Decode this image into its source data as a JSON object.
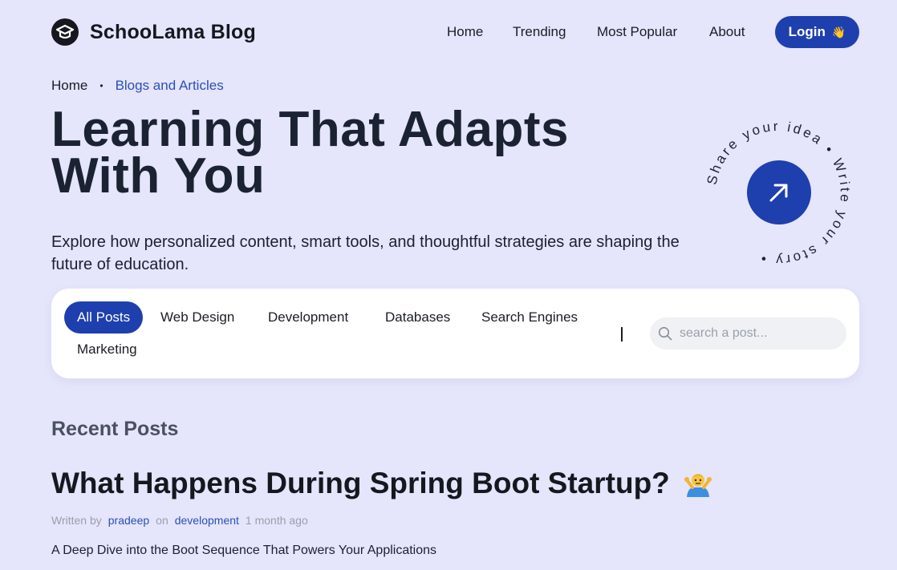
{
  "header": {
    "brand": "SchooLama Blog",
    "nav": [
      "Home",
      "Trending",
      "Most Popular",
      "About"
    ],
    "login_label": "Login",
    "login_emoji": "👋"
  },
  "breadcrumb": {
    "home": "Home",
    "separator": "•",
    "current": "Blogs and Articles"
  },
  "hero": {
    "title_line1": "Learning That Adapts",
    "title_line2": "With You",
    "description": "Explore how personalized content, smart tools, and thoughtful strategies are shaping the future of education.",
    "circle_text": "Share your idea • Write your story •"
  },
  "filters": {
    "categories": [
      "All Posts",
      "Web Design",
      "Development",
      "Databases",
      "Search Engines",
      "Marketing"
    ],
    "active": "All Posts",
    "search_placeholder": "search a post..."
  },
  "posts": {
    "section_title": "Recent Posts",
    "items": [
      {
        "title": "What Happens During Spring Boot Startup?",
        "written_by_label": "Written by",
        "author": "pradeep",
        "on_label": "on",
        "category": "development",
        "time": "1 month ago",
        "excerpt": "A Deep Dive into the Boot Sequence That Powers Your Applications"
      }
    ]
  },
  "colors": {
    "background": "#e5e5fb",
    "accent": "#1e3fae",
    "link": "#2b4fb8"
  },
  "icons": [
    "graduation-cap-icon",
    "arrow-up-right-icon",
    "search-icon",
    "shrug-emoji-icon"
  ]
}
